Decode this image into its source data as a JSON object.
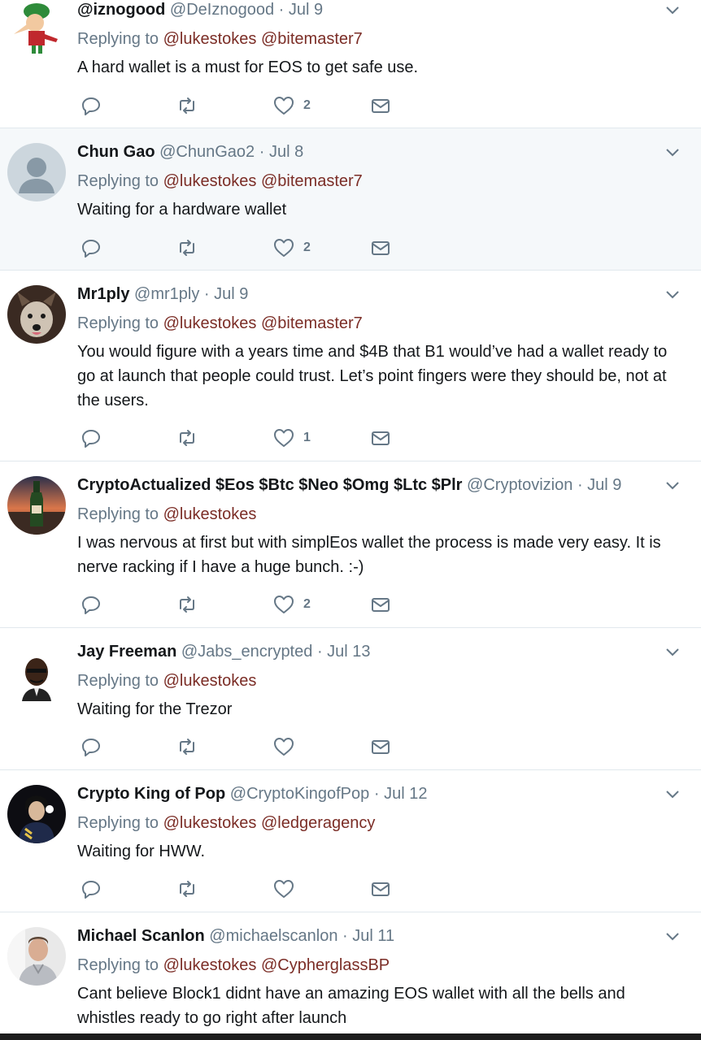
{
  "colors": {
    "accent_mention": "#7b2d26",
    "muted": "#657786",
    "divider": "#e1e8ed",
    "highlight_bg": "#f5f8fa"
  },
  "tweets": [
    {
      "name": "@iznogood",
      "handle": "@DeIznogood",
      "sep": "·",
      "date": "Jul 9",
      "replying_label": "Replying to",
      "mentions": [
        "@lukestokes",
        "@bitemaster7"
      ],
      "text": "A hard wallet is a must for EOS to get safe use.",
      "likes": "2",
      "avatar": "cartoon-character-avatar"
    },
    {
      "name": "Chun Gao",
      "handle": "@ChunGao2",
      "sep": "·",
      "date": "Jul 8",
      "replying_label": "Replying to",
      "mentions": [
        "@lukestokes",
        "@bitemaster7"
      ],
      "text": "Waiting for a hardware wallet",
      "likes": "2",
      "avatar": "default-user-avatar"
    },
    {
      "name": "Mr1ply",
      "handle": "@mr1ply",
      "sep": "·",
      "date": "Jul 9",
      "replying_label": "Replying to",
      "mentions": [
        "@lukestokes",
        "@bitemaster7"
      ],
      "text": "You would figure with a years time and $4B that B1 would’ve had a wallet ready to go at launch that people could trust. Let’s point fingers were they should be, not at the users.",
      "likes": "1",
      "avatar": "dog-avatar"
    },
    {
      "name": "CryptoActualized $Eos $Btc $Neo $Omg $Ltc $Plr",
      "handle": "@Cryptovizion",
      "sep": "·",
      "date": "Jul 9",
      "replying_label": "Replying to",
      "mentions": [
        "@lukestokes"
      ],
      "text": "I was nervous at first but with simplEos wallet the process is made very easy. It is nerve racking if I have a huge bunch. :-)",
      "likes": "2",
      "avatar": "bottle-sunset-avatar"
    },
    {
      "name": "Jay Freeman",
      "handle": "@Jabs_encrypted",
      "sep": "·",
      "date": "Jul 13",
      "replying_label": "Replying to",
      "mentions": [
        "@lukestokes"
      ],
      "text": "Waiting for the Trezor",
      "likes": "",
      "avatar": "emoji-person-avatar"
    },
    {
      "name": "Crypto King of Pop",
      "handle": "@CryptoKingofPop",
      "sep": "·",
      "date": "Jul 12",
      "replying_label": "Replying to",
      "mentions": [
        "@lukestokes",
        "@ledgeragency"
      ],
      "text": "Waiting for HWW.",
      "likes": "",
      "avatar": "performer-avatar"
    },
    {
      "name": "Michael Scanlon",
      "handle": "@michaelscanlon",
      "sep": "·",
      "date": "Jul 11",
      "replying_label": "Replying to",
      "mentions": [
        "@lukestokes",
        "@CypherglassBP"
      ],
      "text": "Cant believe Block1 didnt have an amazing EOS wallet with all the bells and whistles ready to go right after launch",
      "likes": "",
      "avatar": "man-photo-avatar"
    }
  ]
}
